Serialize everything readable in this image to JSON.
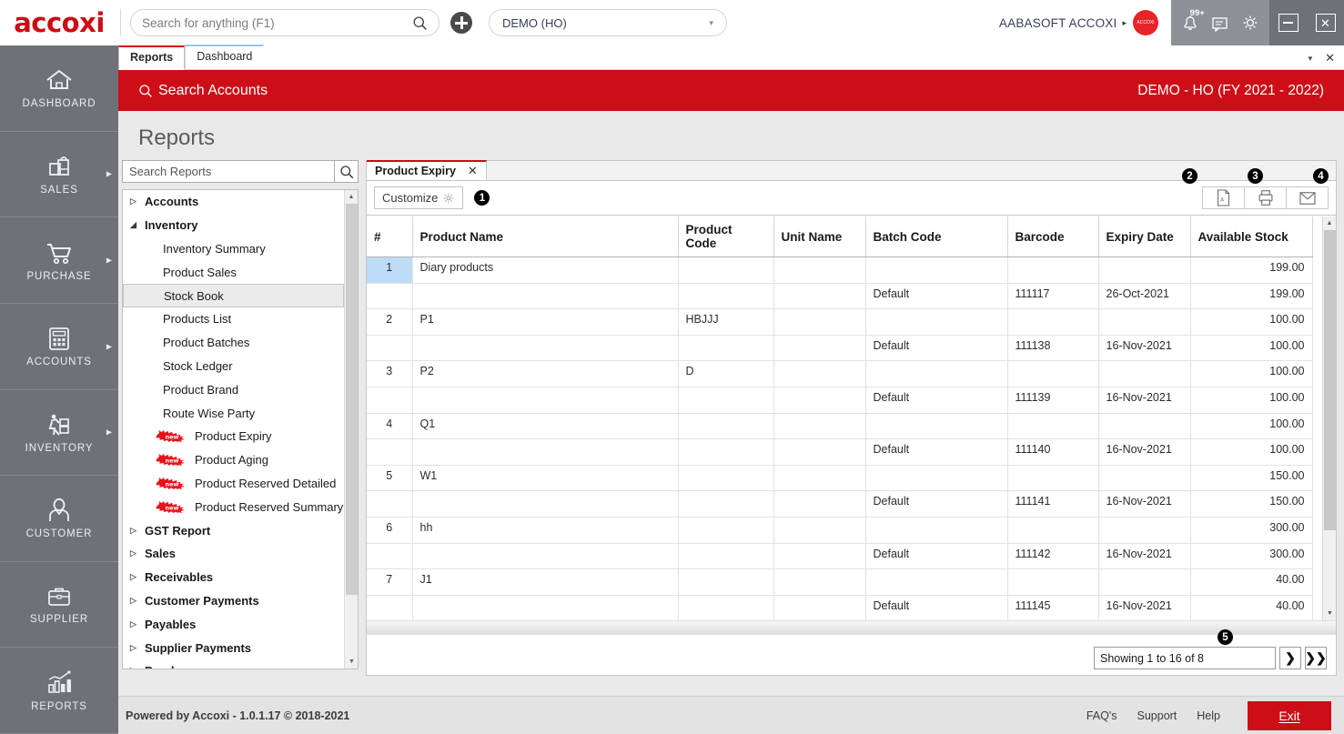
{
  "header": {
    "logo_text": "accoxi",
    "search": {
      "placeholder": "Search for anything (F1)",
      "value": ""
    },
    "add_icon": "plus-icon",
    "company": {
      "label": "DEMO (HO)",
      "caret": "▾"
    },
    "user_name": "AABASOFT ACCOXI",
    "user_arrow": "▸",
    "avatar_text": "ACCOXI",
    "notification_count": "99+",
    "icons": [
      "bell-icon",
      "message-icon",
      "gear-icon"
    ],
    "window_controls": [
      "minimize",
      "close"
    ]
  },
  "leftnav": {
    "items": [
      {
        "label": "DASHBOARD",
        "icon": "home-icon",
        "has_arrow": false
      },
      {
        "label": "SALES",
        "icon": "shopping-bag-icon",
        "has_arrow": true
      },
      {
        "label": "PURCHASE",
        "icon": "shopping-cart-icon",
        "has_arrow": true
      },
      {
        "label": "ACCOUNTS",
        "icon": "calculator-icon",
        "has_arrow": true
      },
      {
        "label": "INVENTORY",
        "icon": "warehouse-worker-icon",
        "has_arrow": true
      },
      {
        "label": "CUSTOMER",
        "icon": "person-icon",
        "has_arrow": false
      },
      {
        "label": "SUPPLIER",
        "icon": "briefcase-icon",
        "has_arrow": false
      },
      {
        "label": "REPORTS",
        "icon": "bar-chart-icon",
        "has_arrow": false
      }
    ]
  },
  "apptabs": {
    "tabs": [
      {
        "label": "Reports",
        "active": true
      },
      {
        "label": "Dashboard",
        "active": false
      }
    ],
    "caret": "▾",
    "close": "✕"
  },
  "redband": {
    "search_label": "Search Accounts",
    "search_icon": "search-icon",
    "fy_label": "DEMO - HO (FY 2021 - 2022)"
  },
  "page": {
    "title": "Reports"
  },
  "tree": {
    "search": {
      "placeholder": "Search Reports",
      "value": ""
    },
    "search_icon": "search-icon",
    "nodes": [
      {
        "label": "Accounts",
        "type": "group",
        "expanded": false
      },
      {
        "label": "Inventory",
        "type": "group",
        "expanded": true
      },
      {
        "label": "Inventory Summary",
        "type": "leaf"
      },
      {
        "label": "Product Sales",
        "type": "leaf"
      },
      {
        "label": "Stock Book",
        "type": "leaf",
        "selected": true
      },
      {
        "label": "Products List",
        "type": "leaf"
      },
      {
        "label": "Product Batches",
        "type": "leaf"
      },
      {
        "label": "Stock Ledger",
        "type": "leaf"
      },
      {
        "label": "Product Brand",
        "type": "leaf"
      },
      {
        "label": "Route Wise Party",
        "type": "leaf"
      },
      {
        "label": "Product Expiry",
        "type": "leaf",
        "badge": "new"
      },
      {
        "label": "Product Aging",
        "type": "leaf",
        "badge": "new"
      },
      {
        "label": "Product Reserved Detailed",
        "type": "leaf",
        "badge": "new"
      },
      {
        "label": "Product Reserved Summary",
        "type": "leaf",
        "badge": "new"
      },
      {
        "label": "GST Report",
        "type": "group",
        "expanded": false
      },
      {
        "label": "Sales",
        "type": "group",
        "expanded": false
      },
      {
        "label": "Receivables",
        "type": "group",
        "expanded": false
      },
      {
        "label": "Customer Payments",
        "type": "group",
        "expanded": false
      },
      {
        "label": "Payables",
        "type": "group",
        "expanded": false
      },
      {
        "label": "Supplier Payments",
        "type": "group",
        "expanded": false
      },
      {
        "label": "Purchase",
        "type": "group",
        "expanded": false
      }
    ]
  },
  "report": {
    "tab_label": "Product Expiry",
    "tab_close": "✕",
    "customize_label": "Customize",
    "customize_icon": "gear-icon",
    "export_buttons": [
      {
        "icon": "pdf-icon",
        "name": "export-pdf"
      },
      {
        "icon": "printer-icon",
        "name": "print"
      },
      {
        "icon": "email-icon",
        "name": "email"
      }
    ],
    "callouts": {
      "customize": "❶",
      "pdf": "❷",
      "print": "❸",
      "email": "❹",
      "pager": "❺"
    }
  },
  "grid": {
    "columns": [
      "#",
      "Product Name",
      "Product Code",
      "Unit Name",
      "Batch Code",
      "Barcode",
      "Expiry Date",
      "Available Stock"
    ],
    "rows": [
      {
        "idx": "1",
        "name": "Diary products",
        "code": "",
        "unit": "",
        "batch": "",
        "barcode": "",
        "expiry": "",
        "stock": "199.00",
        "selected": true
      },
      {
        "idx": "",
        "name": "",
        "code": "",
        "unit": "",
        "batch": "Default",
        "barcode": "111117",
        "expiry": "26-Oct-2021",
        "stock": "199.00"
      },
      {
        "idx": "2",
        "name": "P1",
        "code": "HBJJJ",
        "unit": "",
        "batch": "",
        "barcode": "",
        "expiry": "",
        "stock": "100.00"
      },
      {
        "idx": "",
        "name": "",
        "code": "",
        "unit": "",
        "batch": "Default",
        "barcode": "111138",
        "expiry": "16-Nov-2021",
        "stock": "100.00"
      },
      {
        "idx": "3",
        "name": "P2",
        "code": "D",
        "unit": "",
        "batch": "",
        "barcode": "",
        "expiry": "",
        "stock": "100.00"
      },
      {
        "idx": "",
        "name": "",
        "code": "",
        "unit": "",
        "batch": "Default",
        "barcode": "111139",
        "expiry": "16-Nov-2021",
        "stock": "100.00"
      },
      {
        "idx": "4",
        "name": "Q1",
        "code": "",
        "unit": "",
        "batch": "",
        "barcode": "",
        "expiry": "",
        "stock": "100.00"
      },
      {
        "idx": "",
        "name": "",
        "code": "",
        "unit": "",
        "batch": "Default",
        "barcode": "111140",
        "expiry": "16-Nov-2021",
        "stock": "100.00"
      },
      {
        "idx": "5",
        "name": "W1",
        "code": "",
        "unit": "",
        "batch": "",
        "barcode": "",
        "expiry": "",
        "stock": "150.00"
      },
      {
        "idx": "",
        "name": "",
        "code": "",
        "unit": "",
        "batch": "Default",
        "barcode": "111141",
        "expiry": "16-Nov-2021",
        "stock": "150.00"
      },
      {
        "idx": "6",
        "name": "hh",
        "code": "",
        "unit": "",
        "batch": "",
        "barcode": "",
        "expiry": "",
        "stock": "300.00"
      },
      {
        "idx": "",
        "name": "",
        "code": "",
        "unit": "",
        "batch": "Default",
        "barcode": "111142",
        "expiry": "16-Nov-2021",
        "stock": "300.00"
      },
      {
        "idx": "7",
        "name": "J1",
        "code": "",
        "unit": "",
        "batch": "",
        "barcode": "",
        "expiry": "",
        "stock": "40.00"
      },
      {
        "idx": "",
        "name": "",
        "code": "",
        "unit": "",
        "batch": "Default",
        "barcode": "111145",
        "expiry": "16-Nov-2021",
        "stock": "40.00"
      }
    ]
  },
  "pager": {
    "status": "Showing 1 to 16 of 8",
    "next_label": "❯",
    "last_label": "❯❯"
  },
  "footer": {
    "powered_by": "Powered by Accoxi - 1.0.1.17 © 2018-2021",
    "links": [
      "FAQ's",
      "Support",
      "Help"
    ],
    "exit_label": "Exit"
  },
  "colors": {
    "brand_red": "#ce0e17",
    "nav_gray": "#6e7278",
    "header_icon_gray": "#8d9097",
    "selection_blue": "#bcdcf7"
  }
}
